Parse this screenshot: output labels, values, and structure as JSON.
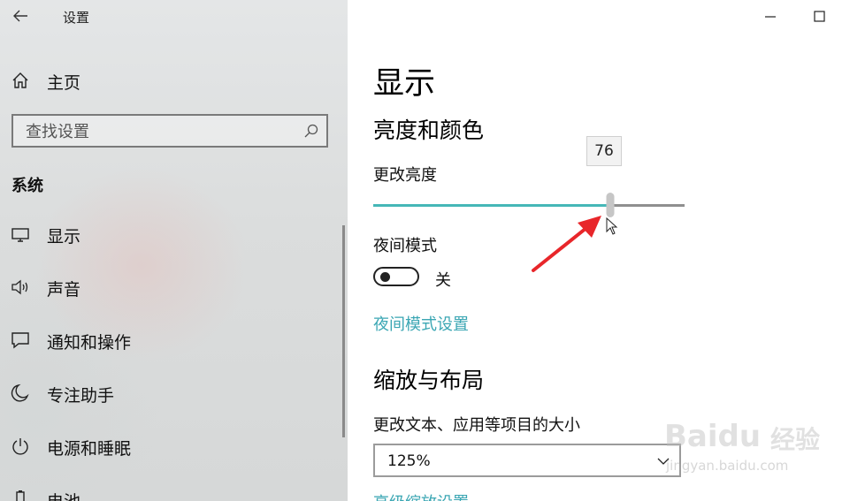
{
  "window": {
    "title": "设置"
  },
  "sidebar": {
    "home_label": "主页",
    "search_placeholder": "查找设置",
    "section_title": "系统",
    "items": [
      {
        "label": "显示",
        "icon": "monitor-icon"
      },
      {
        "label": "声音",
        "icon": "speaker-icon"
      },
      {
        "label": "通知和操作",
        "icon": "notification-icon"
      },
      {
        "label": "专注助手",
        "icon": "moon-icon"
      },
      {
        "label": "电源和睡眠",
        "icon": "power-icon"
      },
      {
        "label": "电池",
        "icon": "battery-icon"
      }
    ]
  },
  "main": {
    "page_title": "显示",
    "brightness_section": "亮度和颜色",
    "brightness_label": "更改亮度",
    "brightness_value": 76,
    "brightness_tooltip": "76",
    "night_mode_label": "夜间模式",
    "night_mode_state": "关",
    "night_mode_on": false,
    "night_mode_link": "夜间模式设置",
    "scale_section": "缩放与布局",
    "scale_label": "更改文本、应用等项目的大小",
    "scale_value": "125%",
    "advanced_scale_link": "高级缩放设置"
  },
  "colors": {
    "accent": "#45b7b7",
    "link": "#3aa6b3",
    "annotation_arrow": "#e8262a"
  },
  "watermark": {
    "brand": "Baidu",
    "brand_cn": "经验",
    "site": "jingyan.baidu.com"
  }
}
